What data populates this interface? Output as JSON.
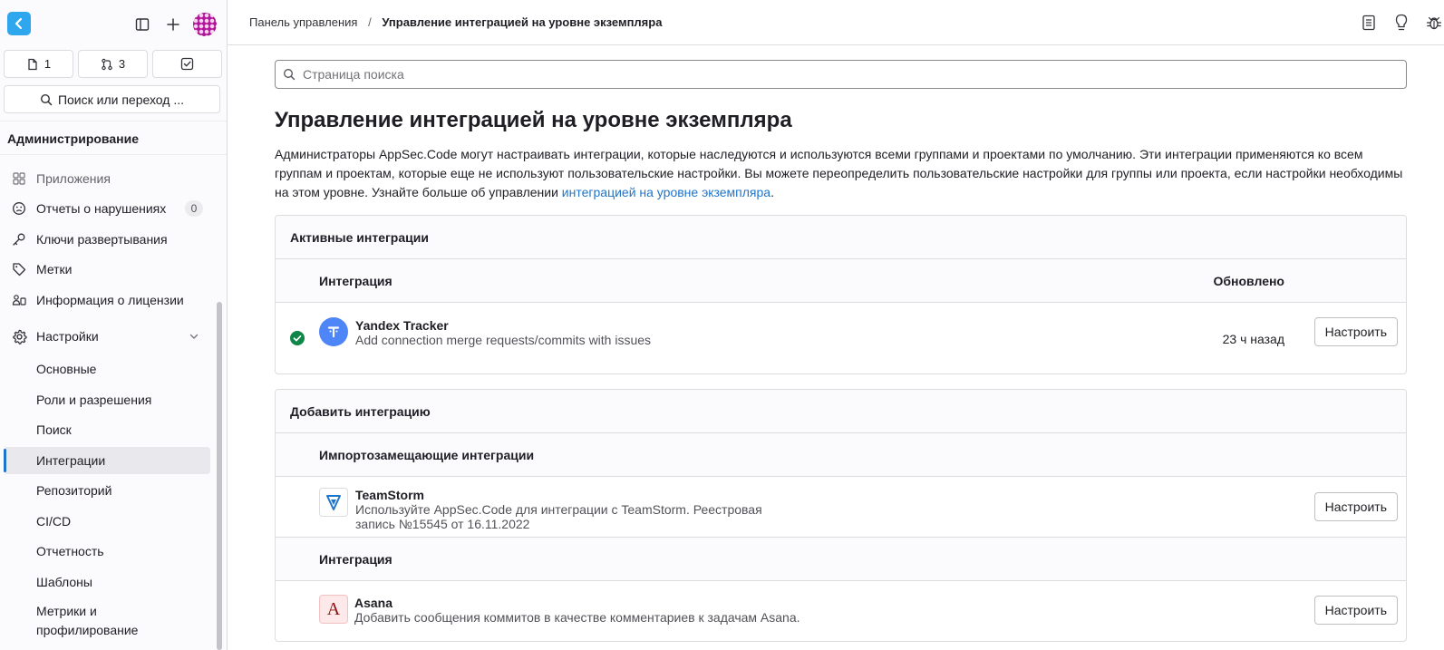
{
  "sidebar": {
    "counters": [
      {
        "icon": "issues-icon",
        "value": "1"
      },
      {
        "icon": "merge-request-icon",
        "value": "3"
      },
      {
        "icon": "todo-icon",
        "value": ""
      }
    ],
    "search_label": "Поиск или переход ...",
    "section_title": "Администрирование",
    "items": {
      "apps": "Приложения",
      "abuse": "Отчеты о нарушениях",
      "abuse_count": "0",
      "deploy_keys": "Ключи развертывания",
      "labels": "Метки",
      "license": "Информация о лицензии",
      "settings": "Настройки"
    },
    "settings_sub": {
      "general": "Основные",
      "roles": "Роли и разрешения",
      "search": "Поиск",
      "integrations": "Интеграции",
      "repository": "Репозиторий",
      "cicd": "CI/CD",
      "reporting": "Отчетность",
      "templates": "Шаблоны",
      "metrics_line1": "Метрики и",
      "metrics_line2": "профилирование"
    }
  },
  "breadcrumb": {
    "root": "Панель управления",
    "separator": "/",
    "current": "Управление интеграцией на уровне экземпляра"
  },
  "page": {
    "search_placeholder": "Страница поиска",
    "title": "Управление интеграцией на уровне экземпляра",
    "description_text": "Администраторы AppSec.Code могут настраивать интеграции, которые наследуются и используются всеми группами и проектами по умолчанию. Эти интеграции применяются ко всем группам и проектам, которые еще не используют пользовательские настройки. Вы можете переопределить пользовательские настройки для группы или проекта, если настройки необходимы на этом уровне. Узнайте больше об управлении ",
    "description_link": "интеграцией на уровне экземпляра",
    "description_end": "."
  },
  "active_card": {
    "header": "Активные интеграции",
    "col_integration": "Интеграция",
    "col_updated": "Обновлено",
    "rows": [
      {
        "name": "Yandex Tracker",
        "description": "Add connection merge requests/commits with issues",
        "updated": "23 ч назад",
        "button": "Настроить"
      }
    ]
  },
  "add_card": {
    "header": "Добавить интеграцию",
    "group1": "Импортозамещающие интеграции",
    "teamstorm": {
      "name": "TeamStorm",
      "description_line1": "Используйте AppSec.Code для интеграции с TeamStorm. Реестровая",
      "description_line2": "запись №15545 от 16.11.2022",
      "button": "Настроить"
    },
    "group2": "Интеграция",
    "asana": {
      "icon_letter": "A",
      "name": "Asana",
      "description": "Добавить сообщения коммитов в качестве комментариев к задачам Asana.",
      "button": "Настроить"
    }
  },
  "colors": {
    "accent": "#1f75cb",
    "success": "#108548",
    "logo": "#2fa7ee",
    "tracker": "#4f86f7"
  }
}
